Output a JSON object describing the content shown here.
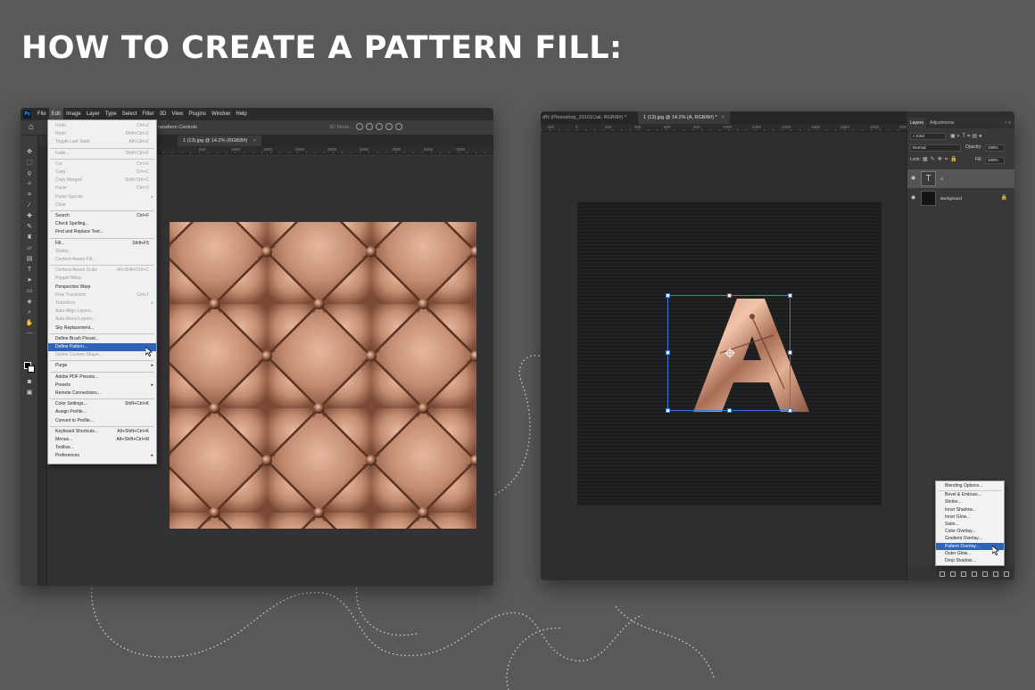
{
  "headline": "HOW TO CREATE A PATTERN FILL:",
  "left_window": {
    "app_logo": "Ps",
    "menubar": [
      "File",
      "Edit",
      "Image",
      "Layer",
      "Type",
      "Select",
      "Filter",
      "3D",
      "View",
      "Plugins",
      "Window",
      "Help"
    ],
    "active_menu": "Edit",
    "options_bar": {
      "label": "ransform Controls",
      "mode_3d": "3D Mode:"
    },
    "document_tab": "1 (13).jpg @ 14.2% (RGB/8#)",
    "ruler_numbers": [
      "500",
      "1000",
      "1500",
      "2000",
      "2500",
      "3000",
      "3500",
      "4000",
      "4500"
    ],
    "edit_menu": [
      {
        "label": "Undo",
        "shortcut": "Ctrl+Z",
        "disabled": true
      },
      {
        "label": "Redo",
        "shortcut": "Shift+Ctrl+Z",
        "disabled": true
      },
      {
        "label": "Toggle Last State",
        "shortcut": "Alt+Ctrl+Z",
        "disabled": true
      },
      {
        "sep": true
      },
      {
        "label": "Fade...",
        "shortcut": "Shift+Ctrl+F",
        "disabled": true
      },
      {
        "sep": true
      },
      {
        "label": "Cut",
        "shortcut": "Ctrl+X",
        "disabled": true
      },
      {
        "label": "Copy",
        "shortcut": "Ctrl+C",
        "disabled": true
      },
      {
        "label": "Copy Merged",
        "shortcut": "Shift+Ctrl+C",
        "disabled": true
      },
      {
        "label": "Paste",
        "shortcut": "Ctrl+V",
        "disabled": true
      },
      {
        "label": "Paste Special",
        "submenu": true,
        "disabled": true
      },
      {
        "label": "Clear",
        "disabled": true
      },
      {
        "sep": true
      },
      {
        "label": "Search",
        "shortcut": "Ctrl+F"
      },
      {
        "label": "Check Spelling..."
      },
      {
        "label": "Find and Replace Text..."
      },
      {
        "sep": true
      },
      {
        "label": "Fill...",
        "shortcut": "Shift+F5"
      },
      {
        "label": "Stroke...",
        "disabled": true
      },
      {
        "label": "Content-Aware Fill...",
        "disabled": true
      },
      {
        "sep": true
      },
      {
        "label": "Content-Aware Scale",
        "shortcut": "Alt+Shift+Ctrl+C",
        "disabled": true
      },
      {
        "label": "Puppet Warp",
        "disabled": true
      },
      {
        "label": "Perspective Warp"
      },
      {
        "label": "Free Transform",
        "shortcut": "Ctrl+T",
        "disabled": true
      },
      {
        "label": "Transform",
        "submenu": true,
        "disabled": true
      },
      {
        "label": "Auto-Align Layers...",
        "disabled": true
      },
      {
        "label": "Auto-Blend Layers...",
        "disabled": true
      },
      {
        "label": "Sky Replacement..."
      },
      {
        "sep": true
      },
      {
        "label": "Define Brush Preset..."
      },
      {
        "label": "Define Pattern...",
        "selected": true
      },
      {
        "label": "Define Custom Shape...",
        "disabled": true
      },
      {
        "sep": true
      },
      {
        "label": "Purge",
        "submenu": true
      },
      {
        "sep": true
      },
      {
        "label": "Adobe PDF Presets..."
      },
      {
        "label": "Presets",
        "submenu": true
      },
      {
        "label": "Remote Connections..."
      },
      {
        "sep": true
      },
      {
        "label": "Color Settings...",
        "shortcut": "Shift+Ctrl+K"
      },
      {
        "label": "Assign Profile..."
      },
      {
        "label": "Convert to Profile..."
      },
      {
        "sep": true
      },
      {
        "label": "Keyboard Shortcuts...",
        "shortcut": "Alt+Shift+Ctrl+K"
      },
      {
        "label": "Menus...",
        "shortcut": "Alt+Shift+Ctrl+M"
      },
      {
        "label": "Toolbar..."
      },
      {
        "label": "Preferences",
        "submenu": true
      }
    ]
  },
  "right_window": {
    "tabs": [
      {
        "label": "d% (Photoshop_29101Cak, RGB/8#) *",
        "active": false
      },
      {
        "label": "1 (13).jpg @ 14.2% (A, RGB/8#) *",
        "active": true
      }
    ],
    "ruler_numbers": [
      "-200",
      "0",
      "200",
      "400",
      "600",
      "800",
      "1000",
      "1200",
      "1400",
      "1600",
      "1800",
      "2000",
      "2200",
      "2400"
    ],
    "canvas_letter": "A",
    "layers_panel": {
      "tabs": [
        "Layers",
        "Adjustments"
      ],
      "filter_kind": "Kind",
      "blend_mode": "Normal",
      "opacity_label": "Opacity:",
      "opacity_value": "100%",
      "lock_label": "Lock:",
      "fill_label": "Fill:",
      "fill_value": "100%",
      "layers": [
        {
          "name": "A",
          "type": "text",
          "selected": true
        },
        {
          "name": "Background",
          "type": "image",
          "locked": true
        }
      ]
    },
    "fx_menu": [
      {
        "label": "Blending Options..."
      },
      {
        "sep": true
      },
      {
        "label": "Bevel & Emboss..."
      },
      {
        "label": "Stroke..."
      },
      {
        "label": "Inner Shadow..."
      },
      {
        "label": "Inner Glow..."
      },
      {
        "label": "Satin..."
      },
      {
        "label": "Color Overlay..."
      },
      {
        "label": "Gradient Overlay..."
      },
      {
        "label": "Pattern Overlay...",
        "selected": true
      },
      {
        "label": "Outer Glow..."
      },
      {
        "label": "Drop Shadow..."
      }
    ]
  },
  "colors": {
    "background": "#595959",
    "highlight": "#2e63b8",
    "copper": "#c58f75",
    "selection_box": "#3b7bd6"
  }
}
